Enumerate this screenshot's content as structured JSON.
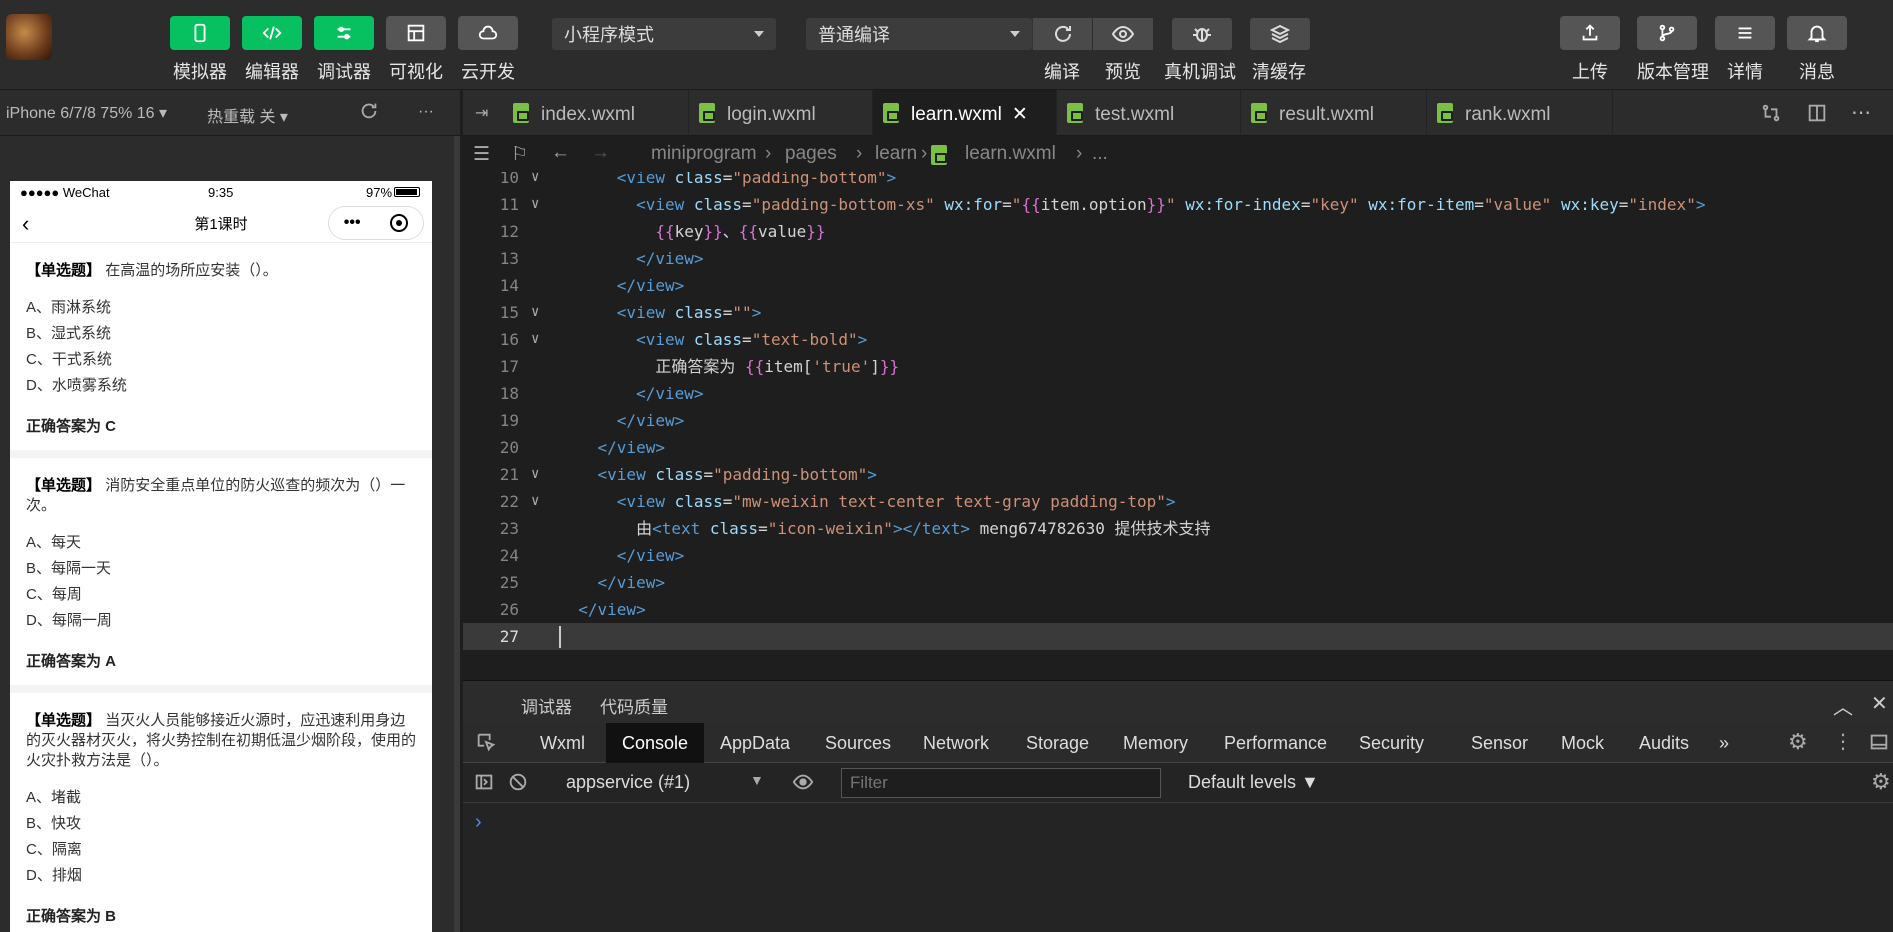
{
  "toolbar": {
    "left_buttons": [
      "模拟器",
      "编辑器",
      "调试器",
      "可视化",
      "云开发"
    ],
    "mode_select": "小程序模式",
    "compile_select": "普通编译",
    "mid_labels": [
      "编译",
      "预览",
      "真机调试",
      "清缓存"
    ],
    "right_labels": [
      "上传",
      "版本管理",
      "详情",
      "消息"
    ],
    "accent": "#07c160"
  },
  "simbar": {
    "device": "iPhone 6/7/8 75% 16",
    "hotreload": "热重载 关",
    "more": "···"
  },
  "phone": {
    "carrier": "●●●●● WeChat",
    "time": "9:35",
    "battery": "97%",
    "title": "第1课时",
    "capsule_dots": "•••",
    "questions": [
      {
        "tag": "【单选题】",
        "text": "在高温的场所应安装（）。",
        "options": [
          "A、雨淋系统",
          "B、湿式系统",
          "C、干式系统",
          "D、水喷雾系统"
        ],
        "answer": "正确答案为 C"
      },
      {
        "tag": "【单选题】",
        "text": "消防安全重点单位的防火巡查的频次为（）一次。",
        "options": [
          "A、每天",
          "B、每隔一天",
          "C、每周",
          "D、每隔一周"
        ],
        "answer": "正确答案为 A"
      },
      {
        "tag": "【单选题】",
        "text": "当灭火人员能够接近火源时，应迅速利用身边的灭火器材灭火，将火势控制在初期低温少烟阶段，使用的火灾扑救方法是（）。",
        "options": [
          "A、堵截",
          "B、快攻",
          "C、隔离",
          "D、排烟"
        ],
        "answer": "正确答案为 B"
      }
    ]
  },
  "editor": {
    "tabs": [
      "index.wxml",
      "login.wxml",
      "learn.wxml",
      "test.wxml",
      "result.wxml",
      "rank.wxml"
    ],
    "active_tab": "learn.wxml",
    "breadcrumb": [
      "miniprogram",
      "pages",
      "learn",
      "learn.wxml",
      "..."
    ],
    "line_numbers": [
      "10",
      "11",
      "12",
      "13",
      "14",
      "15",
      "16",
      "17",
      "18",
      "19",
      "20",
      "21",
      "22",
      "23",
      "24",
      "25",
      "26",
      "27"
    ]
  },
  "debugger": {
    "header": [
      "调试器",
      "代码质量"
    ],
    "tabs": [
      "Wxml",
      "Console",
      "AppData",
      "Sources",
      "Network",
      "Storage",
      "Memory",
      "Performance",
      "Security",
      "Sensor",
      "Mock",
      "Audits",
      "»"
    ],
    "active_tab": "Console",
    "context": "appservice (#1)",
    "filter_placeholder": "Filter",
    "levels": "Default levels ▼",
    "prompt": "›"
  }
}
